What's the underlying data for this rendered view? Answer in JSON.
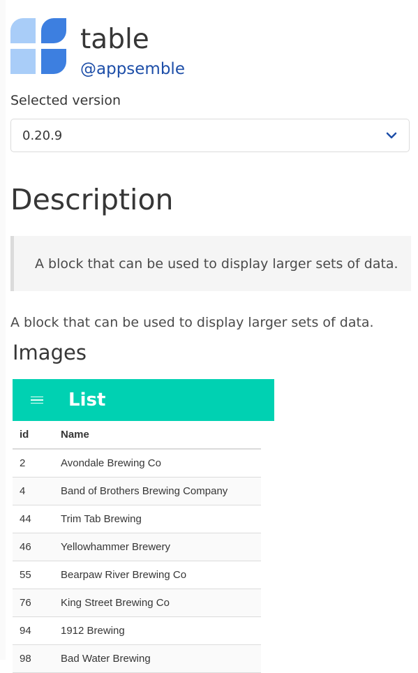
{
  "header": {
    "title": "table",
    "organization": "@appsemble"
  },
  "version": {
    "label": "Selected version",
    "selected": "0.20.9"
  },
  "description": {
    "heading": "Description",
    "quote": "A block that can be used to display larger sets of data.",
    "text": "A block that can be used to display larger sets of data."
  },
  "images": {
    "heading": "Images",
    "screenshot": {
      "app_title": "List",
      "columns": [
        "id",
        "Name"
      ],
      "rows": [
        [
          "2",
          "Avondale Brewing Co"
        ],
        [
          "4",
          "Band of Brothers Brewing Company"
        ],
        [
          "44",
          "Trim Tab Brewing"
        ],
        [
          "46",
          "Yellowhammer Brewery"
        ],
        [
          "55",
          "Bearpaw River Brewing Co"
        ],
        [
          "76",
          "King Street Brewing Co"
        ],
        [
          "94",
          "1912 Brewing"
        ],
        [
          "98",
          "Bad Water Brewing"
        ]
      ]
    }
  },
  "colors": {
    "accent": "#00d1b2",
    "link": "#1d4ea8",
    "logo_light": "#a9cdf8",
    "logo_dark": "#3d7fe0"
  },
  "icons": {
    "logo": "appsemble-logo",
    "chevron": "chevron-down-icon",
    "menu": "hamburger-menu-icon"
  }
}
